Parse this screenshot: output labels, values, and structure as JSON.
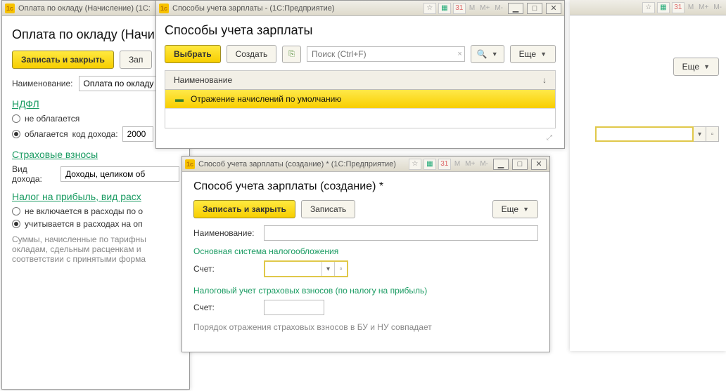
{
  "bg_window": {
    "toolbar": {
      "more_label": "Еще",
      "dropdown_value": ""
    }
  },
  "win1": {
    "titlebar": "Оплата по окладу (Начисление) (1С:",
    "page_title": "Оплата по окладу (Начи",
    "btn_save_close": "Записать и закрыть",
    "btn_save": "Зап",
    "name_label": "Наименование:",
    "name_value": "Оплата по окладу",
    "section_ndfl": "НДФЛ",
    "radio_not_taxed": "не облагается",
    "radio_taxed": "облагается",
    "code_label": "код дохода:",
    "code_value": "2000",
    "section_insurance": "Страховые взносы",
    "income_type_label": "Вид дохода:",
    "income_type_value": "Доходы, целиком об",
    "section_profit_tax": "Налог на прибыль, вид расх",
    "radio_not_included": "не включается в расходы по о",
    "radio_included": "учитывается в расходах на оп",
    "footnote": "Суммы, начисленные по тарифны\nокладам, сдельным расценкам и\nсоответствии с принятыми форма"
  },
  "win2": {
    "titlebar": "Способы учета зарплаты - (1С:Предприятие)",
    "page_title": "Способы учета зарплаты",
    "btn_select": "Выбрать",
    "btn_create": "Создать",
    "search_placeholder": "Поиск (Ctrl+F)",
    "btn_more": "Еще",
    "col_name": "Наименование",
    "row1": "Отражение начислений по умолчанию"
  },
  "win3": {
    "titlebar": "Способ учета зарплаты (создание) * (1С:Предприятие)",
    "page_title": "Способ учета зарплаты (создание) *",
    "btn_save_close": "Записать и закрыть",
    "btn_save": "Записать",
    "btn_more": "Еще",
    "name_label": "Наименование:",
    "name_value": "",
    "section_main": "Основная система налогообложения",
    "account_label": "Счет:",
    "account_value": "",
    "section_tax": "Налоговый учет страховых взносов (по налогу на прибыль)",
    "account2_label": "Счет:",
    "account2_value": "",
    "note": "Порядок отражения страховых взносов в БУ и НУ совпадает"
  }
}
